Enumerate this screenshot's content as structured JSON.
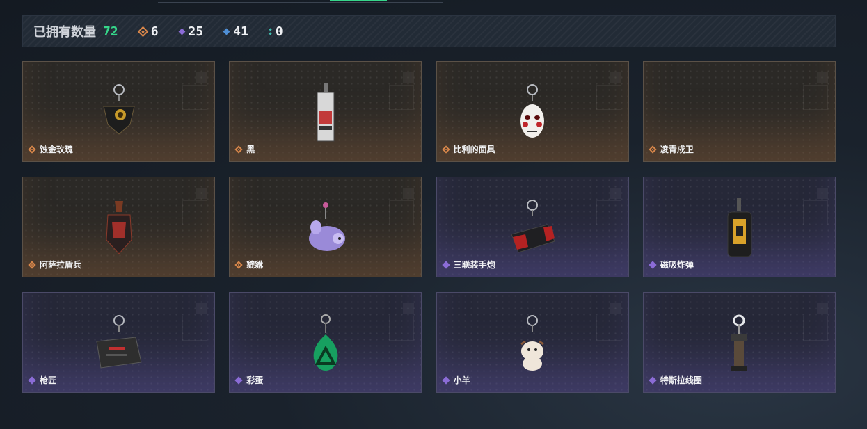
{
  "stats": {
    "label": "已拥有数量",
    "total": "72",
    "counts": [
      {
        "icon": "orange-diamond-icon",
        "value": "6"
      },
      {
        "icon": "purple-diamond-icon",
        "value": "25"
      },
      {
        "icon": "blue-diamond-icon",
        "value": "41"
      },
      {
        "icon": "teal-dots-icon",
        "value": "0"
      }
    ]
  },
  "colors": {
    "accent": "#36d68a",
    "orange": "#d9874a",
    "purple": "#8b6cd6",
    "blue": "#4f8fd6",
    "teal": "#3fc0b0"
  },
  "items": [
    {
      "name": "蚀金玫瑰",
      "rarity": "orange",
      "icon": "golden-rose-charm-icon"
    },
    {
      "name": "黑",
      "rarity": "orange",
      "icon": "card-tag-charm-icon"
    },
    {
      "name": "比利的面具",
      "rarity": "orange",
      "icon": "billy-mask-charm-icon"
    },
    {
      "name": "凌青戍卫",
      "rarity": "orange",
      "icon": "guard-charm-icon"
    },
    {
      "name": "阿萨拉盾兵",
      "rarity": "orange",
      "icon": "shield-soldier-charm-icon"
    },
    {
      "name": "貔貅",
      "rarity": "orange",
      "icon": "pixiu-charm-icon"
    },
    {
      "name": "三联装手炮",
      "rarity": "purple",
      "icon": "hand-cannon-charm-icon"
    },
    {
      "name": "磁吸炸弹",
      "rarity": "purple",
      "icon": "magnetic-bomb-charm-icon"
    },
    {
      "name": "枪匠",
      "rarity": "purple",
      "icon": "gunsmith-charm-icon"
    },
    {
      "name": "彩蛋",
      "rarity": "purple",
      "icon": "easter-egg-charm-icon"
    },
    {
      "name": "小羊",
      "rarity": "purple",
      "icon": "lamb-charm-icon"
    },
    {
      "name": "特斯拉线圈",
      "rarity": "purple",
      "icon": "tesla-coil-charm-icon"
    }
  ]
}
